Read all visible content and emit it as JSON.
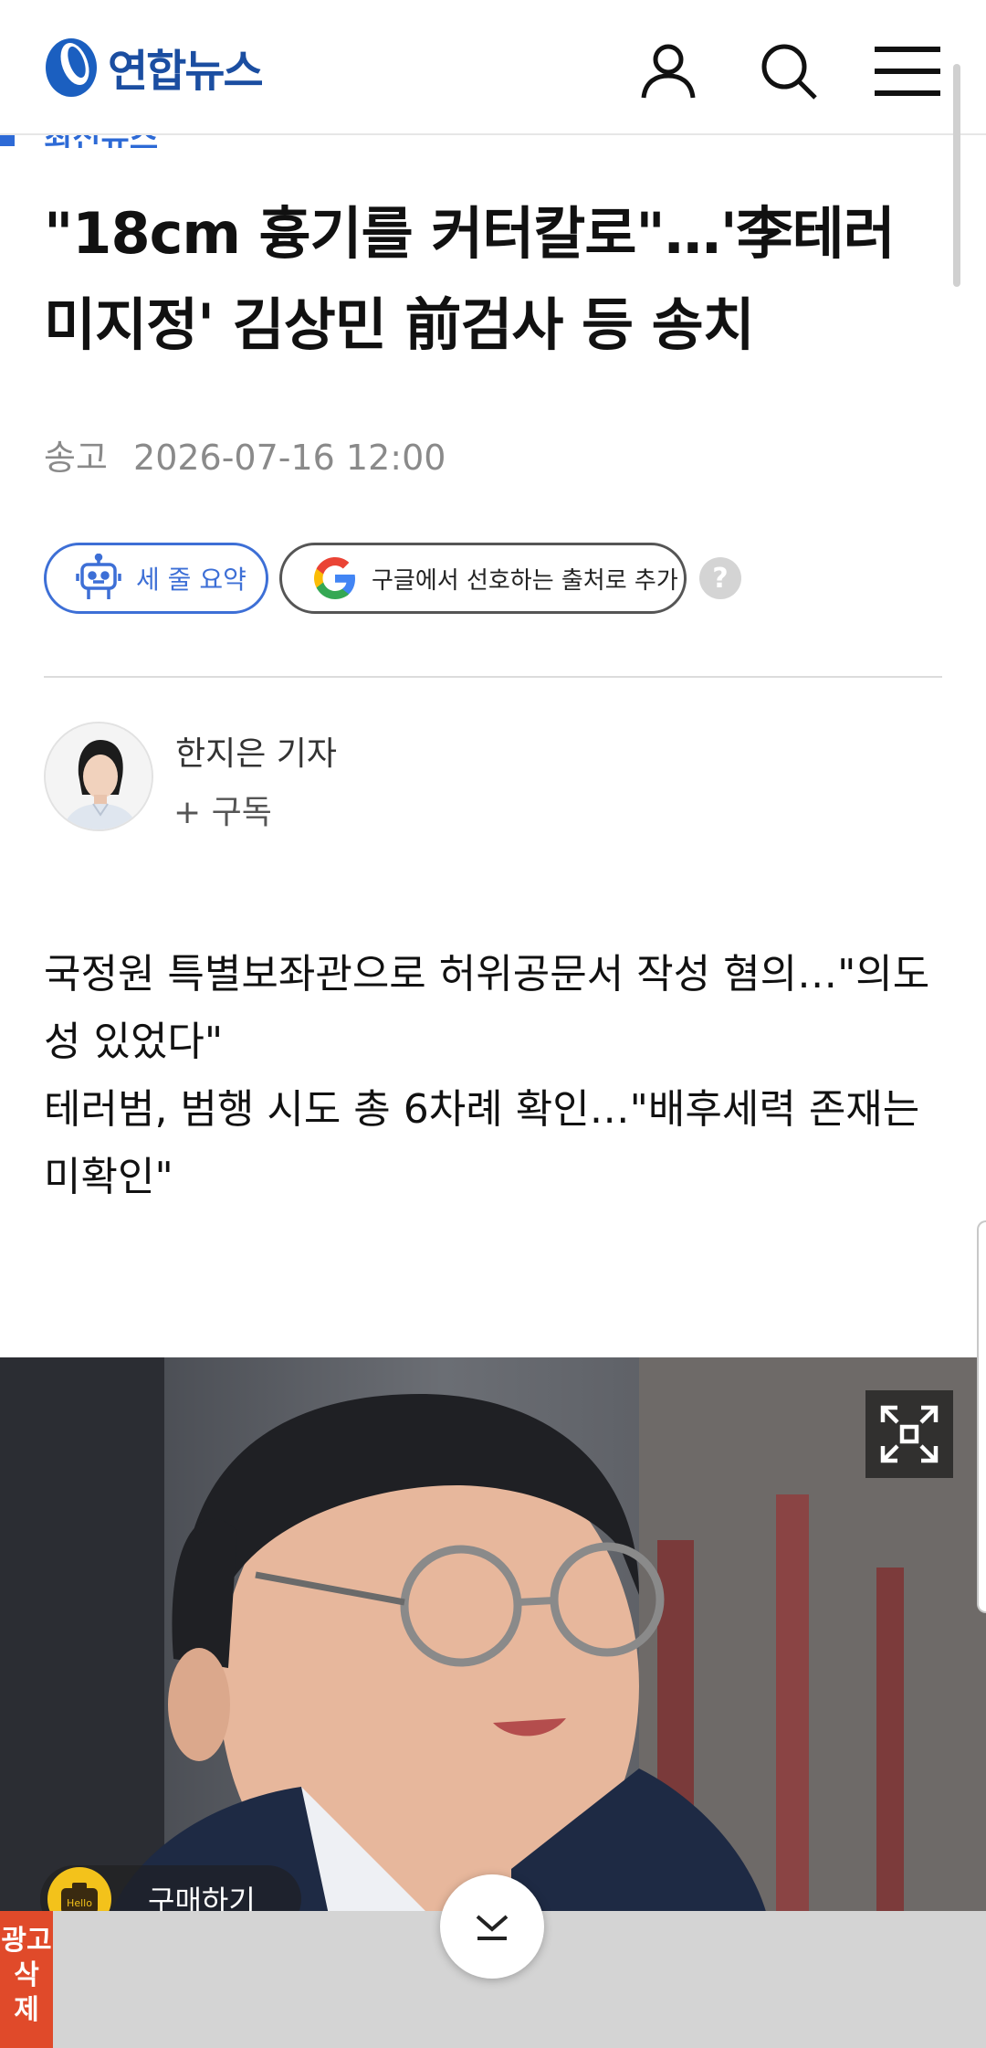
{
  "header": {
    "logo_text": "연합뉴스",
    "icons": [
      "user-icon",
      "search-icon",
      "menu-icon"
    ]
  },
  "category": {
    "label": "최신뉴스"
  },
  "article": {
    "title": "\"18cm 흉기를 커터칼로\"…'李테러 미지정' 김상민 前검사 등 송치",
    "date_label": "송고",
    "date_value": "2026-07-16 12:00",
    "summary_button": "세 줄 요약",
    "google_button": "구글에서 선호하는 출처로 추가",
    "help_label": "?",
    "reporter": "한지은 기자",
    "subscribe": "+ 구독",
    "summary": [
      "국정원 특별보좌관으로 허위공문서 작성 혐의…\"의도성 있었다\"",
      "테러범, 범행 시도 총 6차례 확인…\"배후세력 존재는 미확인\""
    ]
  },
  "photo": {
    "buy_label": "구매하기",
    "camera_badge": "Hello"
  },
  "ad": {
    "remove_label": [
      "광고",
      "삭",
      "제"
    ]
  },
  "colors": {
    "brand": "#1b4ea1",
    "accent": "#3d6fd6",
    "ad_remove": "#e04a2a"
  }
}
